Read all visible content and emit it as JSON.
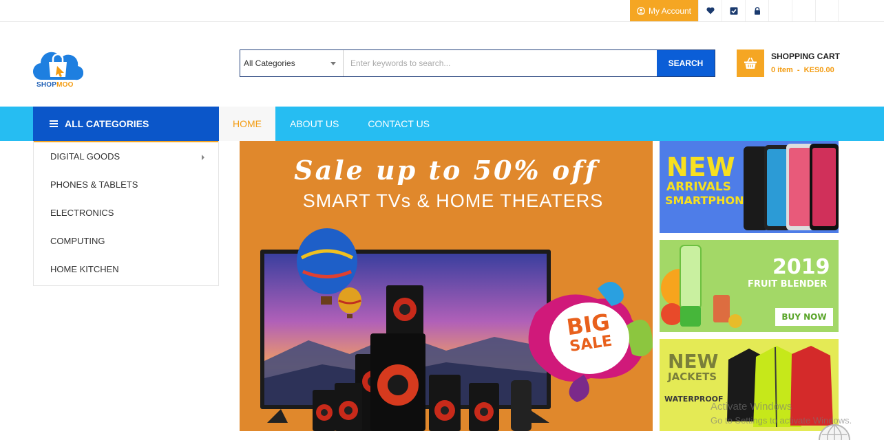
{
  "topbar": {
    "account_label": "My Account",
    "icons": [
      "user-circle-icon",
      "heart-icon",
      "checkbox-icon",
      "lock-icon"
    ]
  },
  "brand": {
    "logo_shop": "SHOP",
    "logo_moo": "MOO"
  },
  "search": {
    "category_selected": "All Categories",
    "placeholder": "Enter keywords to search...",
    "button_label": "SEARCH"
  },
  "cart": {
    "title": "SHOPPING CART",
    "summary": "0 item  -  KES0.00"
  },
  "nav": {
    "all_categories": "ALL CATEGORIES",
    "links": [
      "HOME",
      "ABOUT US",
      "CONTACT US"
    ]
  },
  "side_menu": {
    "items": [
      "DIGITAL GOODS",
      "PHONES & TABLETS",
      "ELECTRONICS",
      "COMPUTING",
      "HOME KITCHEN"
    ]
  },
  "main_banner": {
    "headline": "Sale up to 50% off",
    "subheadline": "SMART TVs & HOME THEATERS",
    "badge_line1": "BIG",
    "badge_line2": "SALE"
  },
  "side_banners": {
    "phones": {
      "line1": "NEW",
      "line2": "ARRIVALS",
      "line3": "SMARTPHONES"
    },
    "blender": {
      "year": "2019",
      "product": "FRUIT BLENDER",
      "cta": "BUY NOW"
    },
    "jackets": {
      "line1": "NEW",
      "line2": "JACKETS",
      "line3": "WATERPROOF"
    }
  },
  "os_watermark": {
    "line1": "Activate Windows",
    "line2": "Go to Settings to activate Windows."
  },
  "colors": {
    "accent_orange": "#f5a623",
    "primary_blue": "#0b56c9",
    "nav_cyan": "#26bdf2",
    "banner_orange": "#e0882c"
  }
}
